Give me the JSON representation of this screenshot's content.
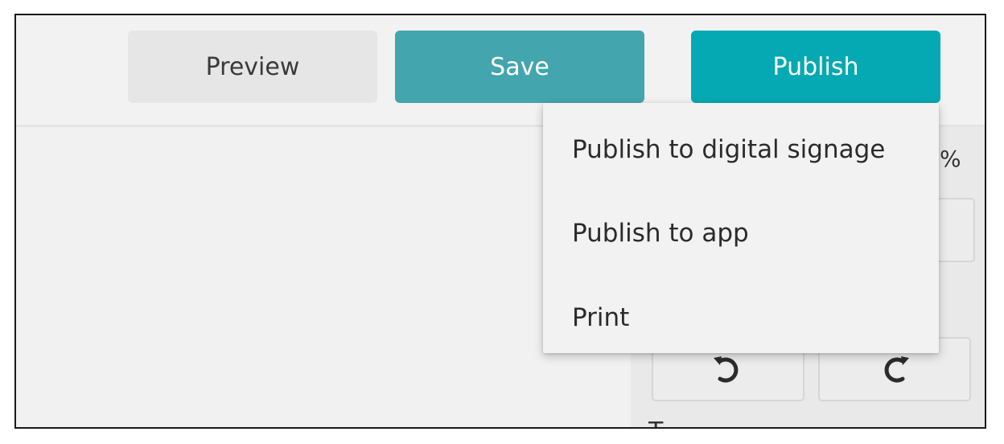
{
  "toolbar": {
    "preview_label": "Preview",
    "save_label": "Save",
    "publish_label": "Publish"
  },
  "publish_menu": {
    "items": [
      {
        "label": "Publish to digital signage"
      },
      {
        "label": "Publish to app"
      },
      {
        "label": "Print"
      }
    ]
  },
  "side_panel": {
    "zoom_unit": "%",
    "undo_icon": "undo-icon",
    "redo_icon": "redo-icon",
    "cut_off_label": "T"
  },
  "colors": {
    "save_button": "#43a5ad",
    "publish_button": "#05a9b3",
    "preview_button": "#e6e6e6"
  }
}
